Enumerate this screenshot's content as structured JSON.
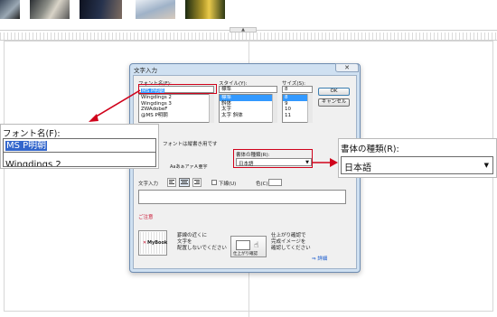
{
  "page": {
    "ruler_tab": "▲"
  },
  "dialog": {
    "title": "文字入力",
    "close": "✕",
    "font_name_label": "フォント名(F):",
    "font_name_value": "MS P明朝",
    "font_list": [
      "Wingdings 2",
      "Wingdings 3",
      "ZWAdobeF",
      "@MS P明朝"
    ],
    "style_label": "スタイル(Y):",
    "style_value": "標準",
    "style_list": [
      "標準",
      "斜体",
      "太字",
      "太字 斜体"
    ],
    "size_label": "サイズ(S):",
    "size_value": "8",
    "size_list": [
      "8",
      "9",
      "10",
      "11"
    ],
    "ok_label": "OK",
    "cancel_label": "キャンセル",
    "vertical_font_note": "フォントは縦書き用です",
    "sample_text": "AaあぁアァＡ亜宇",
    "script_label": "書体の種類(R):",
    "script_value": "日本語",
    "text_input_label": "文字入力",
    "underline_label": "下線(U)",
    "color_label": "色(C)",
    "note_heading": "ご注意",
    "note_logo": "MyBook",
    "note_text_1": "罫線の近くに\n文字を\n配置しないでください",
    "preview_button": "仕上がり確認",
    "note_text_2": "仕上がり確認で\n完成イメージを\n確認してください",
    "detail_link": "詳細"
  },
  "callout_font": {
    "label": "フォント名(F):",
    "value": "MS P明朝",
    "next_item": "Wingdings 2"
  },
  "callout_script": {
    "label": "書体の種類(R):",
    "value": "日本語",
    "dropdown_arrow": "▼"
  },
  "colors": {
    "highlight": "#d0021b",
    "selection": "#3366cc",
    "dialog_frame": "#cfe0f1"
  }
}
